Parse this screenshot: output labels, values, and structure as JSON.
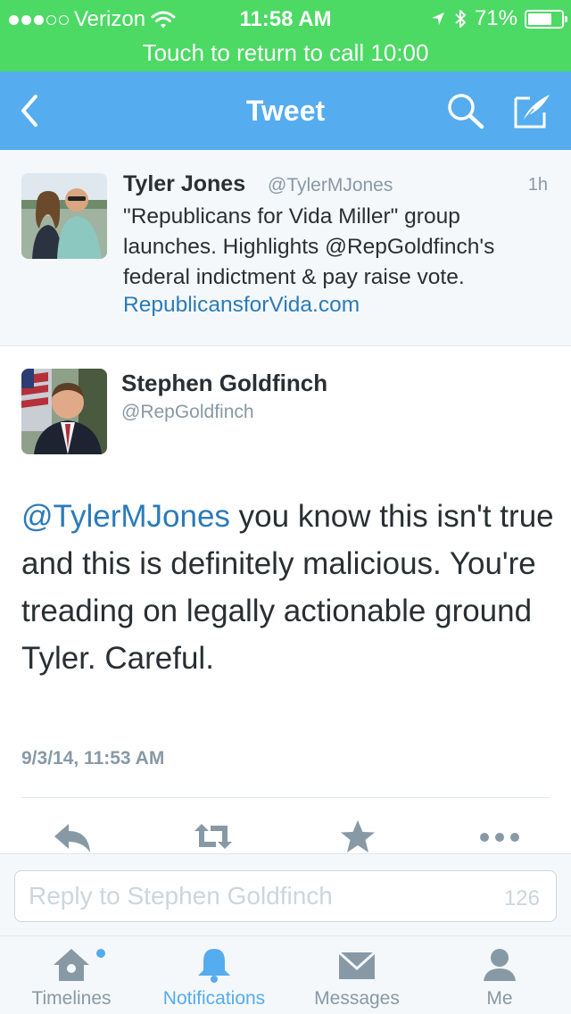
{
  "status_bar": {
    "carrier": "Verizon",
    "time": "11:58 AM",
    "battery_text": "71%",
    "battery_level": 0.71,
    "signal_bars_filled": 3,
    "signal_bars_total": 5
  },
  "call_banner": {
    "text": "Touch to return to call  10:00"
  },
  "nav": {
    "title": "Tweet"
  },
  "parent_tweet": {
    "name": "Tyler Jones",
    "handle": "@TylerMJones",
    "time": "1h",
    "text": "\"Republicans for Vida Miller\" group launches. Highlights @RepGoldfinch's federal indictment & pay raise vote.",
    "link": "RepublicansforVida.com"
  },
  "main_tweet": {
    "name": "Stephen Goldfinch",
    "handle": "@RepGoldfinch",
    "mention": "@TylerMJones",
    "text": " you know this isn't true and this is definitely malicious.  You're treading on legally actionable ground Tyler. Careful.",
    "date": "9/3/14, 11:53 AM"
  },
  "reply": {
    "placeholder": "Reply to Stephen Goldfinch",
    "char_count": "126"
  },
  "tabs": [
    {
      "label": "Timelines",
      "icon": "home-icon"
    },
    {
      "label": "Notifications",
      "icon": "bell-icon"
    },
    {
      "label": "Messages",
      "icon": "envelope-icon"
    },
    {
      "label": "Me",
      "icon": "person-icon"
    }
  ],
  "colors": {
    "status_green": "#4cd964",
    "twitter_blue": "#55acee",
    "link_blue": "#2b7bb9",
    "grey_text": "#8899a6"
  }
}
